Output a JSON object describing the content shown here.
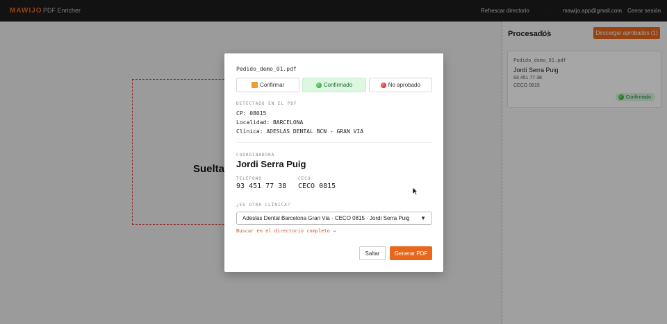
{
  "topbar": {
    "brand": "MAWIJO",
    "subtitle": "PDF Enricher",
    "refresh": "Refrescar directorio",
    "sep": "·",
    "email": "mawijo.app@gmail.com",
    "logout": "Cerrar sesión"
  },
  "dropzone": {
    "text": "Suelta"
  },
  "panel": {
    "title": "Procesados",
    "count": "(1)",
    "download": "Descargar aprobados (1)",
    "card": {
      "file": "Pedido_demo_01.pdf",
      "name": "Jordi Serra Puig",
      "phone": "93 451 77 38",
      "ceco": "CECO 0815",
      "badge": "Confirmado"
    }
  },
  "modal": {
    "file": "Pedido_demo_01.pdf",
    "status": {
      "confirm": "Confirmar",
      "confirmed": "Confirmado",
      "rejected": "No aprobado"
    },
    "detected_label": "DETECTADO EN EL PDF",
    "cp": "CP: 08015",
    "locality": "Localidad: BARCELONA",
    "clinic": "Clínica: ADESLAS DENTAL BCN - GRAN VIA",
    "coord_label": "COORDINADORA",
    "coord_name": "Jordi Serra Puig",
    "tel_label": "TELÉFONO",
    "tel": "93 451 77 38",
    "ceco_label": "CECO",
    "ceco": "CECO 0815",
    "other_label": "¿ES OTRA CLÍNICA?",
    "select_value": "Adeslas Dental Barcelona Gran Via · CECO 0815 · Jordi Serra Puig",
    "dir_link": "Buscar en el directorio completo →",
    "skip": "Saltar",
    "generate": "Generar PDF"
  },
  "colors": {
    "accent": "#e8671c",
    "confirmed_bg": "#ddf7e1",
    "topbar": "#1c1c1c"
  },
  "icons": [
    "orange-square-icon",
    "green-dot-icon",
    "red-dot-icon",
    "chevron-down-icon",
    "cursor-icon"
  ]
}
